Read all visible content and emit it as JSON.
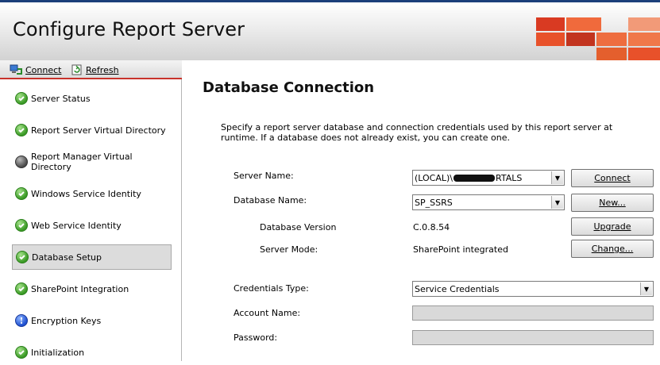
{
  "app": {
    "title": "Configure Report Server"
  },
  "toolbar": {
    "connect_label": "Connect",
    "refresh_label": "Refresh"
  },
  "sidebar": {
    "items": [
      {
        "label": "Server Status",
        "status": "ok"
      },
      {
        "label": "Report Server Virtual Directory",
        "status": "ok"
      },
      {
        "label": "Report Manager Virtual Directory",
        "status": "unavailable"
      },
      {
        "label": "Windows Service Identity",
        "status": "ok"
      },
      {
        "label": "Web Service Identity",
        "status": "ok"
      },
      {
        "label": "Database Setup",
        "status": "ok",
        "selected": true
      },
      {
        "label": "SharePoint Integration",
        "status": "ok"
      },
      {
        "label": "Encryption Keys",
        "status": "info"
      },
      {
        "label": "Initialization",
        "status": "ok"
      }
    ]
  },
  "main": {
    "title": "Database Connection",
    "description": "Specify a report server database and connection credentials used by this report server at runtime. If a database does not already exist, you can create one.",
    "server_name": {
      "label": "Server Name:",
      "value_prefix": "(LOCAL)\\",
      "value_suffix": "RTALS"
    },
    "database_name": {
      "label": "Database Name:",
      "value": "SP_SSRS"
    },
    "database_version": {
      "label": "Database Version",
      "value": "C.0.8.54"
    },
    "server_mode": {
      "label": "Server Mode:",
      "value": "SharePoint integrated"
    },
    "credentials_type": {
      "label": "Credentials Type:",
      "value": "Service Credentials"
    },
    "account_name": {
      "label": "Account Name:",
      "value": ""
    },
    "password": {
      "label": "Password:",
      "value": ""
    },
    "buttons": {
      "connect": "Connect",
      "new": "New...",
      "upgrade": "Upgrade",
      "change": "Change..."
    }
  },
  "colors": {
    "accent_red": "#c8322b",
    "logo_orange": "#e8512a",
    "ok_green": "#3a9a25",
    "info_blue": "#1d4fd0"
  }
}
